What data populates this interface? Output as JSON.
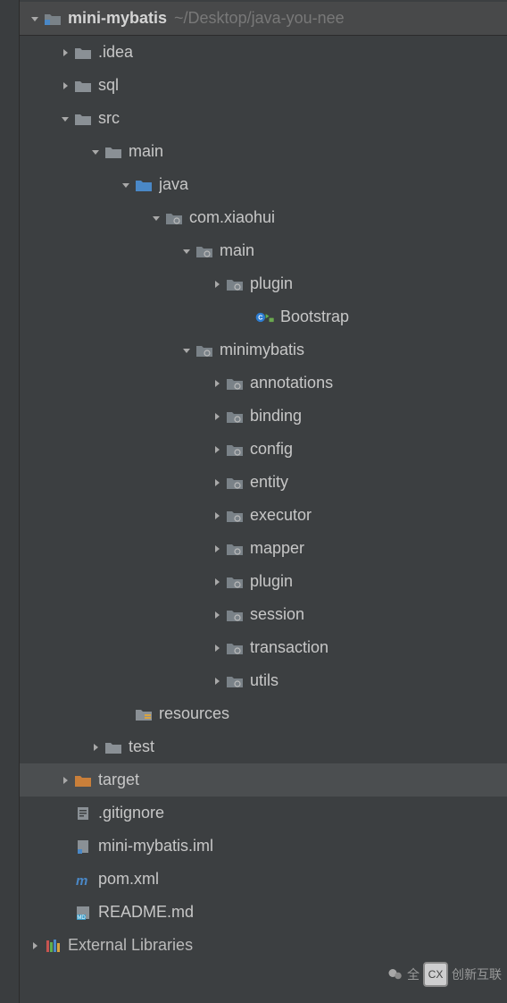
{
  "project": {
    "name": "mini-mybatis",
    "path": "~/Desktop/java-you-nee"
  },
  "externalLibraries": "External Libraries",
  "watermark": {
    "text": "创新互联",
    "prefix": "全"
  },
  "tree": [
    {
      "depth": 0,
      "arrow": "down",
      "icon": "module-folder",
      "label": "mini-mybatis",
      "bold": true,
      "pathSuffix": true,
      "header": true
    },
    {
      "depth": 1,
      "arrow": "right",
      "icon": "folder",
      "label": ".idea"
    },
    {
      "depth": 1,
      "arrow": "right",
      "icon": "folder",
      "label": "sql"
    },
    {
      "depth": 1,
      "arrow": "down",
      "icon": "folder",
      "label": "src"
    },
    {
      "depth": 2,
      "arrow": "down",
      "icon": "folder",
      "label": "main"
    },
    {
      "depth": 3,
      "arrow": "down",
      "icon": "source-folder",
      "label": "java"
    },
    {
      "depth": 4,
      "arrow": "down",
      "icon": "package",
      "label": "com.xiaohui"
    },
    {
      "depth": 5,
      "arrow": "down",
      "icon": "package",
      "label": "main"
    },
    {
      "depth": 6,
      "arrow": "right",
      "icon": "package",
      "label": "plugin"
    },
    {
      "depth": 7,
      "arrow": "none",
      "icon": "class-run",
      "label": "Bootstrap"
    },
    {
      "depth": 5,
      "arrow": "down",
      "icon": "package",
      "label": "minimybatis"
    },
    {
      "depth": 6,
      "arrow": "right",
      "icon": "package",
      "label": "annotations"
    },
    {
      "depth": 6,
      "arrow": "right",
      "icon": "package",
      "label": "binding"
    },
    {
      "depth": 6,
      "arrow": "right",
      "icon": "package",
      "label": "config"
    },
    {
      "depth": 6,
      "arrow": "right",
      "icon": "package",
      "label": "entity"
    },
    {
      "depth": 6,
      "arrow": "right",
      "icon": "package",
      "label": "executor"
    },
    {
      "depth": 6,
      "arrow": "right",
      "icon": "package",
      "label": "mapper"
    },
    {
      "depth": 6,
      "arrow": "right",
      "icon": "package",
      "label": "plugin"
    },
    {
      "depth": 6,
      "arrow": "right",
      "icon": "package",
      "label": "session"
    },
    {
      "depth": 6,
      "arrow": "right",
      "icon": "package",
      "label": "transaction"
    },
    {
      "depth": 6,
      "arrow": "right",
      "icon": "package",
      "label": "utils"
    },
    {
      "depth": 3,
      "arrow": "none",
      "icon": "resources-folder",
      "label": "resources"
    },
    {
      "depth": 2,
      "arrow": "right",
      "icon": "folder",
      "label": "test"
    },
    {
      "depth": 1,
      "arrow": "right",
      "icon": "target-folder",
      "label": "target",
      "selected": true
    },
    {
      "depth": 1,
      "arrow": "none",
      "icon": "text-file",
      "label": ".gitignore"
    },
    {
      "depth": 1,
      "arrow": "none",
      "icon": "iml-file",
      "label": "mini-mybatis.iml"
    },
    {
      "depth": 1,
      "arrow": "none",
      "icon": "maven-file",
      "label": "pom.xml"
    },
    {
      "depth": 1,
      "arrow": "none",
      "icon": "md-file",
      "label": "README.md"
    }
  ]
}
